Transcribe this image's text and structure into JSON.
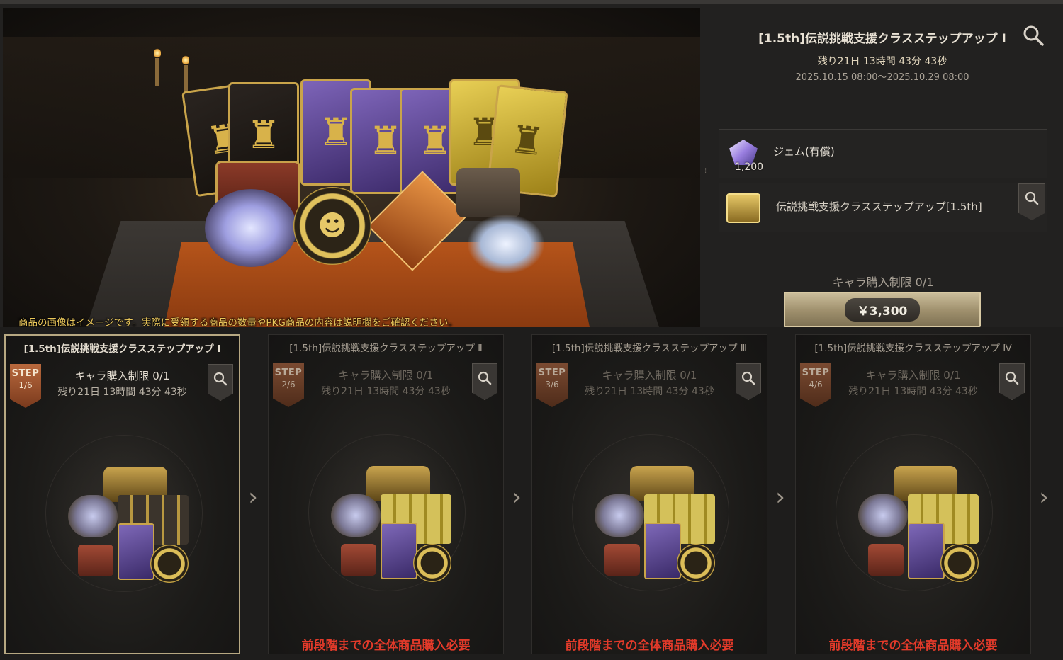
{
  "hero": {
    "notice": "商品の画像はイメージです。実際に受領する商品の数量やPKG商品の内容は説明欄をご確認ください。"
  },
  "package": {
    "title": "[1.5th]伝説挑戦支援クラスステップアップ Ⅰ",
    "remaining": "残り21日 13時間 43分 43秒",
    "period": "2025.10.15 08:00～2025.10.29 08:00",
    "items": [
      {
        "icon": "gem-icon",
        "name": "ジェム(有償)",
        "count": "1,200"
      },
      {
        "icon": "treasure-box-icon",
        "name": "[1.5th]伝説挑戦支援クラスステップアップ"
      }
    ],
    "purchase_limit": "キャラ購入制限 0/1",
    "price": "￥3,300"
  },
  "steps": [
    {
      "title": "[1.5th]伝説挑戦支援クラスステップアップ Ⅰ",
      "badge_step": "STEP",
      "badge_progress": "1/6",
      "limit": "キャラ購入制限 0/1",
      "remaining": "残り21日 13時間 43分 43秒",
      "requirement": ""
    },
    {
      "title": "[1.5th]伝説挑戦支援クラスステップアップ Ⅱ",
      "badge_step": "STEP",
      "badge_progress": "2/6",
      "limit": "キャラ購入制限 0/1",
      "remaining": "残り21日 13時間 43分 43秒",
      "requirement": "前段階までの全体商品購入必要"
    },
    {
      "title": "[1.5th]伝説挑戦支援クラスステップアップ Ⅲ",
      "badge_step": "STEP",
      "badge_progress": "3/6",
      "limit": "キャラ購入制限 0/1",
      "remaining": "残り21日 13時間 43分 43秒",
      "requirement": "前段階までの全体商品購入必要"
    },
    {
      "title": "[1.5th]伝説挑戦支援クラスステップアップ Ⅳ",
      "badge_step": "STEP",
      "badge_progress": "4/6",
      "limit": "キャラ購入制限 0/1",
      "remaining": "残り21日 13時間 43分 43秒",
      "requirement": "前段階までの全体商品購入必要"
    }
  ],
  "colors": {
    "accent_gold": "#e9c65a",
    "warning_red": "#e23a2a",
    "step_badge": "#b9693d"
  }
}
